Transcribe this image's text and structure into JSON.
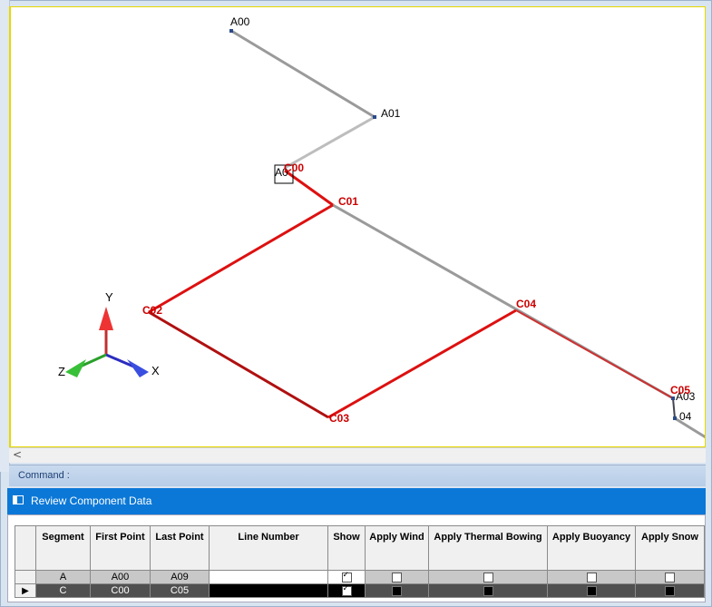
{
  "viewport": {
    "points_black": [
      "A00",
      "A01",
      "A03",
      "04"
    ],
    "point_overlap_label": "A0",
    "points_red": [
      "C00",
      "C01",
      "C02",
      "C03",
      "C04",
      "C05"
    ],
    "axes": {
      "y": "Y",
      "x": "X",
      "z": "Z"
    },
    "colors": {
      "segment_a": "#9a9a9a",
      "segment_c": "#dd1010"
    }
  },
  "scrollbar": {
    "left_arrow": "<"
  },
  "command": {
    "label": "Command :"
  },
  "panel": {
    "title": "Review Component Data",
    "columns": [
      "Segment",
      "First Point",
      "Last Point",
      "Line Number",
      "Show",
      "Apply Wind",
      "Apply Thermal Bowing",
      "Apply Buoyancy",
      "Apply Snow"
    ],
    "rows": [
      {
        "segment": "A",
        "first_point": "A00",
        "last_point": "A09",
        "line_number": "",
        "show": true,
        "apply_wind": false,
        "apply_thermal_bowing": false,
        "apply_buoyancy": false,
        "apply_snow": false
      },
      {
        "segment": "C",
        "first_point": "C00",
        "last_point": "C05",
        "line_number": "",
        "show": true,
        "apply_wind": false,
        "apply_thermal_bowing": false,
        "apply_buoyancy": false,
        "apply_snow": false
      }
    ]
  }
}
